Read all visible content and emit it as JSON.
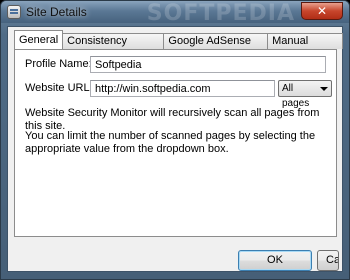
{
  "window": {
    "title": "Site Details",
    "watermark": "SOFTPEDIA",
    "close_glyph": "✕"
  },
  "tabs": [
    {
      "label": "General",
      "active": true
    },
    {
      "label": "Consistency Check",
      "active": false
    },
    {
      "label": "Google AdSense ID",
      "active": false
    },
    {
      "label": "Manual Rules",
      "active": false
    }
  ],
  "general": {
    "profile_name_label": "Profile Name:",
    "profile_name_value": "Softpedia",
    "website_url_label": "Website URL:",
    "website_url_value": "http://win.softpedia.com",
    "scan_scope_selected": "All pages",
    "info_line1": "Website Security Monitor will recursively scan all pages from this site.",
    "info_line2": "You can limit the number of scanned pages by selecting the appropriate value from the dropdown box."
  },
  "buttons": {
    "ok_label": "OK",
    "cancel_label": "Cancel"
  },
  "icons": {
    "app": "window-app-icon",
    "close": "close-icon",
    "dropdown": "chevron-down-icon"
  }
}
